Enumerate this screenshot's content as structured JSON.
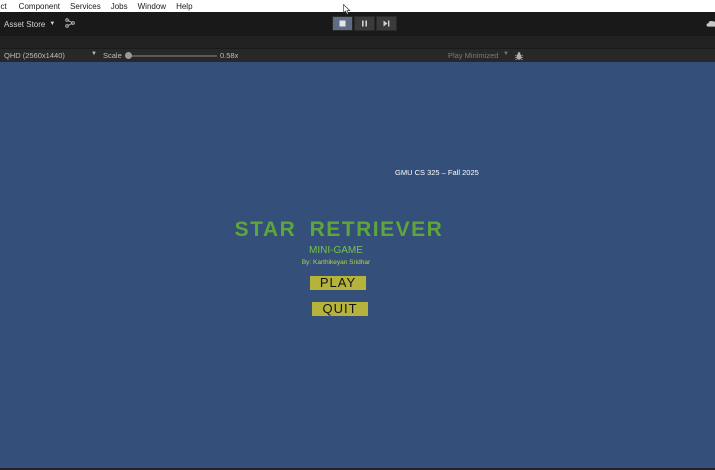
{
  "menubar": {
    "items": [
      "ect",
      "Component",
      "Services",
      "Jobs",
      "Window",
      "Help"
    ]
  },
  "toolbar": {
    "asset_store_label": "Asset Store",
    "active_control": "stop",
    "accent": "#5e6d83"
  },
  "game_toolbar": {
    "resolution": "QHD (2560x1440)",
    "scale_label": "Scale",
    "scale_value": "0.58x",
    "play_mode": "Play Minimized"
  },
  "game_view": {
    "background": "#344f7a",
    "course": "GMU CS 325 – Fall 2025",
    "title": "STAR RETRIEVER",
    "subtitle": "MINI-GAME",
    "author": "By: Karthikeyan Sridhar",
    "play_button": "PLAY",
    "quit_button": "QUIT",
    "title_color": "#5fa63a",
    "button_color": "#b6b33c"
  }
}
